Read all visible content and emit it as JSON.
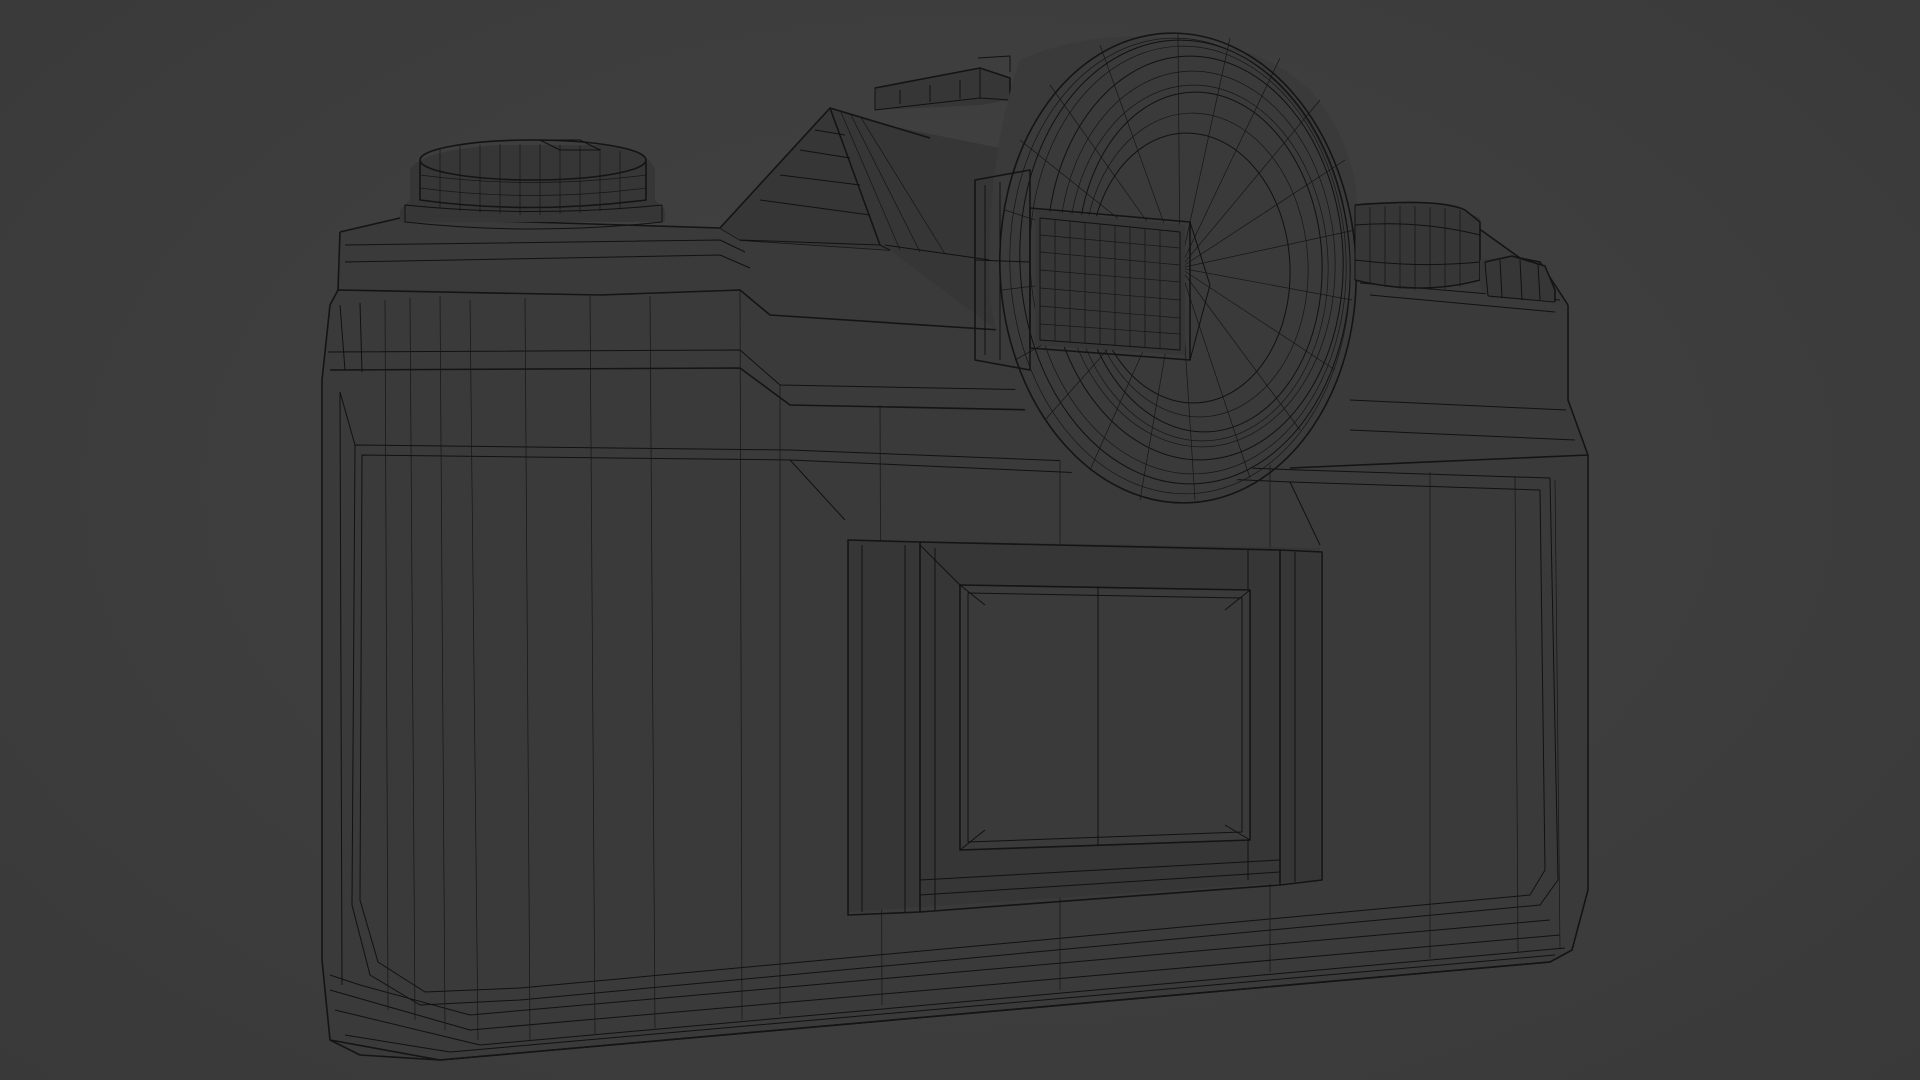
{
  "viewport": {
    "background_color": "#3d3d3d",
    "wire_color": "#111111",
    "display_mode": "wireframe"
  },
  "model": {
    "subject": "film-slr-camera-back",
    "parts": [
      "camera-body",
      "rewind-knob",
      "prism-hump",
      "hot-shoe",
      "eyecup",
      "viewfinder-window",
      "shutter-dial",
      "advance-lever",
      "back-door",
      "film-window"
    ]
  }
}
